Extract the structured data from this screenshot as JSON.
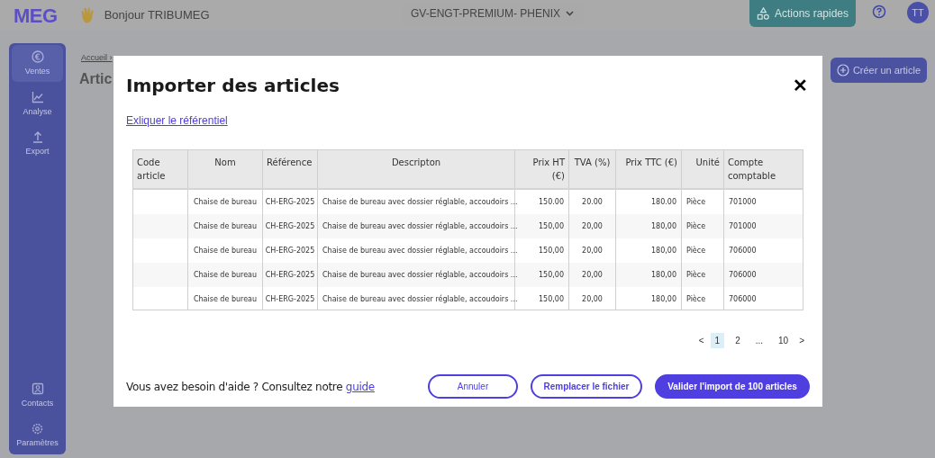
{
  "header": {
    "logo": "MEG",
    "greeting": "Bonjour TRIBUMEG",
    "company": "GV-ENGT-PREMIUM- PHENIX",
    "quick_actions": "Actions rapides",
    "avatar": "TT"
  },
  "sidebar": {
    "items": [
      {
        "label": "Ventes",
        "selected": true
      },
      {
        "label": "Analyse",
        "selected": false
      },
      {
        "label": "Export",
        "selected": false
      }
    ],
    "bottom_items": [
      {
        "label": "Contacts",
        "selected": false
      },
      {
        "label": "Paramètres",
        "selected": false
      }
    ]
  },
  "page": {
    "breadcrumb": "Accueil ›",
    "title": "Artic",
    "create_button": "Créer un article"
  },
  "modal": {
    "title": "Importer des articles",
    "close": "✕",
    "explain_link": "Exliquer le référentiel",
    "table": {
      "columns": [
        "Code article",
        "Nom",
        "Référence",
        "Descripton",
        "Prix HT (€)",
        "TVA (%)",
        "Prix TTC (€)",
        "Unité",
        "Compte comptable"
      ],
      "rows": [
        [
          "",
          "Chaise de bureau",
          "CH-ERG-2025",
          "Chaise de bureau avec dossier réglable, accoudoirs ...",
          "150.00",
          "20.00",
          "180.00",
          "Pièce",
          "701000"
        ],
        [
          "",
          "Chaise de bureau",
          "CH-ERG-2025",
          "Chaise de bureau avec dossier réglable, accoudoirs ...",
          "150,00",
          "20,00",
          "180,00",
          "Pièce",
          "701000"
        ],
        [
          "",
          "Chaise de bureau",
          "CH-ERG-2025",
          "Chaise de bureau avec dossier réglable, accoudoirs ...",
          "150,00",
          "20,00",
          "180,00",
          "Pièce",
          "706000"
        ],
        [
          "",
          "Chaise de bureau",
          "CH-ERG-2025",
          "Chaise de bureau avec dossier réglable, accoudoirs ...",
          "150,00",
          "20,00",
          "180,00",
          "Pièce",
          "706000"
        ],
        [
          "",
          "Chaise de bureau",
          "CH-ERG-2025",
          "Chaise de bureau avec dossier réglable, accoudoirs ...",
          "150,00",
          "20,00",
          "180,00",
          "Pièce",
          "706000"
        ]
      ]
    },
    "pagination": {
      "prev": "<",
      "pages": [
        {
          "label": "1",
          "selected": true
        },
        {
          "label": "2",
          "selected": false
        },
        {
          "label": "...",
          "selected": false
        },
        {
          "label": "10",
          "selected": false
        }
      ],
      "next": ">"
    },
    "help_text": "Vous avez besoin d'aide ? Consultez notre",
    "help_link": "guide",
    "buttons": [
      {
        "label": "Annuler",
        "kind": "outline"
      },
      {
        "label": "Remplacer le fichier",
        "kind": "outline"
      },
      {
        "label": "Valider l'import de 100 articles",
        "kind": "primary"
      }
    ]
  }
}
